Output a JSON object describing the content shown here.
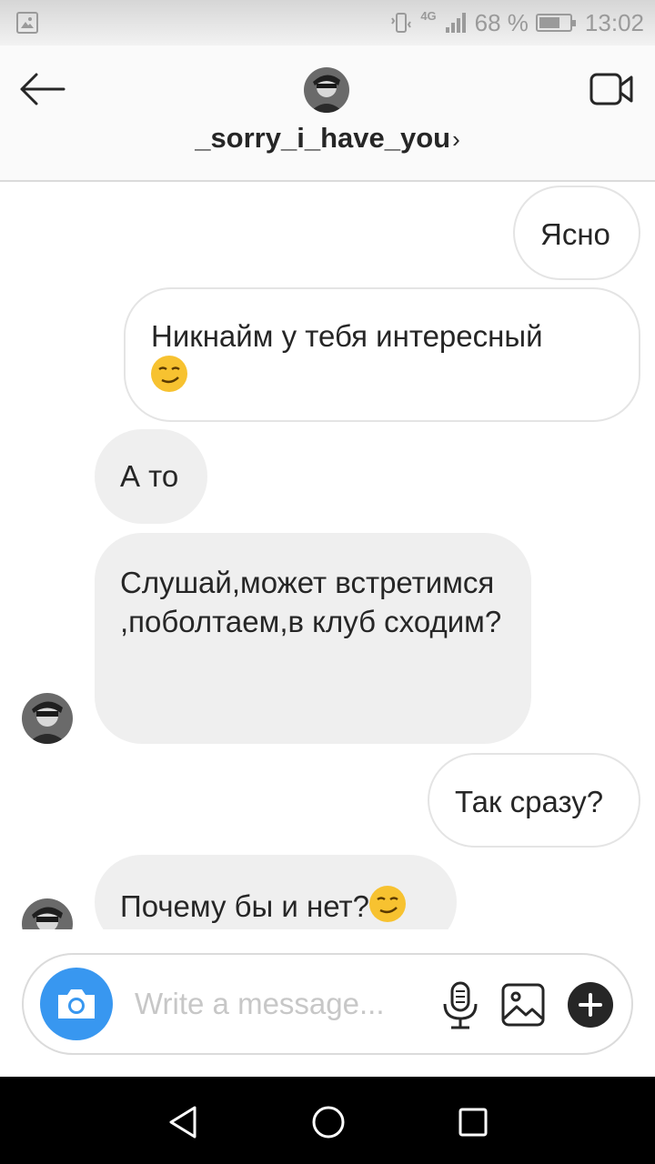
{
  "status_bar": {
    "network": "4G",
    "battery_percent": "68 %",
    "battery_level": 0.68,
    "time": "13:02"
  },
  "header": {
    "username": "_sorry_i_have_you",
    "chevron": "›",
    "back_icon": "arrow-left-icon",
    "video_icon": "video-camera-icon"
  },
  "messages": [
    {
      "direction": "sent",
      "text": "Ясно"
    },
    {
      "direction": "sent",
      "text": "Никнайм у тебя интересный",
      "emoji": "smirk-emoji"
    },
    {
      "direction": "received",
      "text": "А то"
    },
    {
      "direction": "received",
      "text": "Слушай,может встретимся ,поболтаем,в клуб сходим?"
    },
    {
      "direction": "sent",
      "text": "Так сразу?"
    },
    {
      "direction": "received",
      "text": "Почему бы и нет?",
      "emoji": "smirk-emoji"
    }
  ],
  "composer": {
    "placeholder": "Write a message...",
    "camera_icon": "camera-icon",
    "mic_icon": "microphone-icon",
    "gallery_icon": "image-icon",
    "add_icon": "plus-icon",
    "accent_color": "#3897f0"
  },
  "nav": {
    "back_icon": "triangle-back-icon",
    "home_icon": "circle-home-icon",
    "recents_icon": "square-recents-icon"
  }
}
